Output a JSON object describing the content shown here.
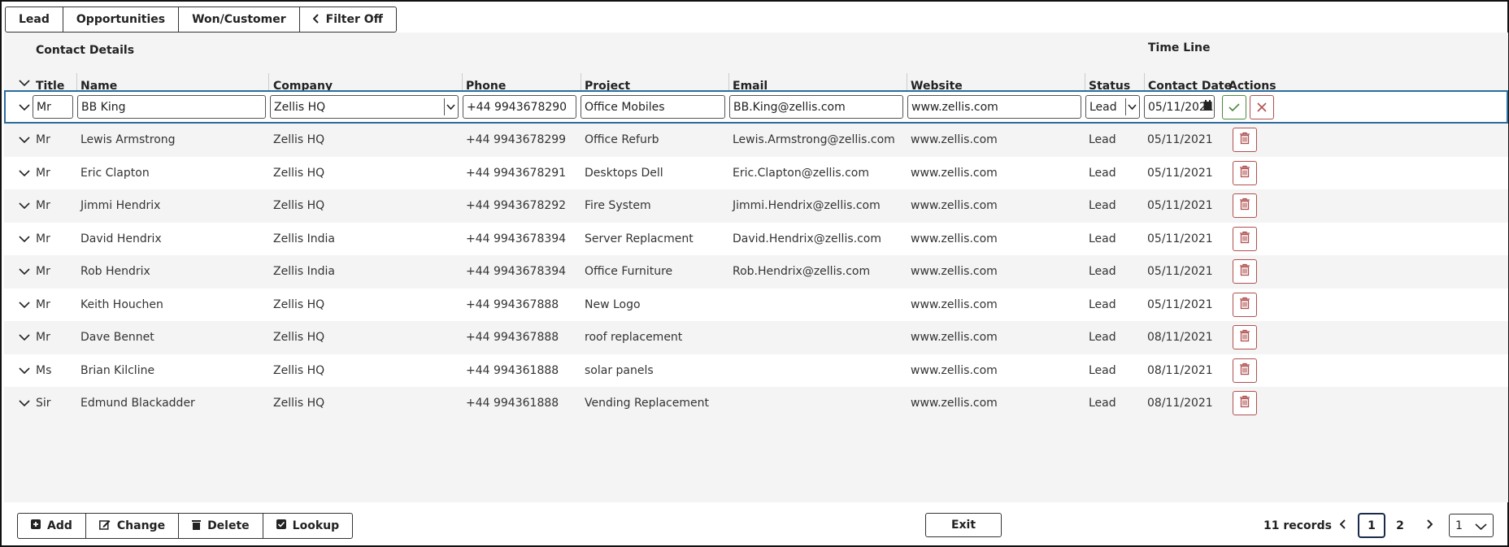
{
  "tabs": [
    {
      "label": "Lead"
    },
    {
      "label": "Opportunities"
    },
    {
      "label": "Won/Customer"
    },
    {
      "label": "Filter Off"
    }
  ],
  "grid": {
    "group_contact": "Contact Details",
    "group_timeline": "Time Line",
    "columns": {
      "title": "Title",
      "name": "Name",
      "company": "Company",
      "phone": "Phone",
      "project": "Project",
      "email": "Email",
      "website": "Website",
      "status": "Status",
      "contact_date": "Contact Date",
      "actions": "Actions"
    },
    "edit_row": {
      "title": "Mr",
      "name": "BB King",
      "company": "Zellis HQ",
      "phone": "+44 9943678290",
      "project": "Office Mobiles",
      "email": "BB.King@zellis.com",
      "website": "www.zellis.com",
      "status": "Lead",
      "contact_date": "05/11/2021"
    },
    "rows": [
      {
        "title": "Mr",
        "name": "Lewis Armstrong",
        "company": "Zellis HQ",
        "phone": "+44 9943678299",
        "project": "Office Refurb",
        "email": "Lewis.Armstrong@zellis.com",
        "website": "www.zellis.com",
        "status": "Lead",
        "date": "05/11/2021"
      },
      {
        "title": "Mr",
        "name": "Eric Clapton",
        "company": "Zellis HQ",
        "phone": "+44 9943678291",
        "project": "Desktops Dell",
        "email": "Eric.Clapton@zellis.com",
        "website": "www.zellis.com",
        "status": "Lead",
        "date": "05/11/2021"
      },
      {
        "title": "Mr",
        "name": "Jimmi Hendrix",
        "company": "Zellis HQ",
        "phone": "+44 9943678292",
        "project": "Fire System",
        "email": "Jimmi.Hendrix@zellis.com",
        "website": "www.zellis.com",
        "status": "Lead",
        "date": "05/11/2021"
      },
      {
        "title": "Mr",
        "name": "David Hendrix",
        "company": "Zellis India",
        "phone": "+44 9943678394",
        "project": "Server Replacment",
        "email": "David.Hendrix@zellis.com",
        "website": "www.zellis.com",
        "status": "Lead",
        "date": "05/11/2021"
      },
      {
        "title": "Mr",
        "name": "Rob Hendrix",
        "company": "Zellis India",
        "phone": "+44 9943678394",
        "project": "Office Furniture",
        "email": "Rob.Hendrix@zellis.com",
        "website": "www.zellis.com",
        "status": "Lead",
        "date": "05/11/2021"
      },
      {
        "title": "Mr",
        "name": "Keith Houchen",
        "company": "Zellis HQ",
        "phone": "+44 994367888",
        "project": "New Logo",
        "email": "",
        "website": "www.zellis.com",
        "status": "Lead",
        "date": "05/11/2021"
      },
      {
        "title": "Mr",
        "name": "Dave Bennet",
        "company": "Zellis HQ",
        "phone": "+44 994367888",
        "project": "roof replacement",
        "email": "",
        "website": "www.zellis.com",
        "status": "Lead",
        "date": "08/11/2021"
      },
      {
        "title": "Ms",
        "name": "Brian Kilcline",
        "company": "Zellis HQ",
        "phone": "+44 994361888",
        "project": "solar panels",
        "email": "",
        "website": "www.zellis.com",
        "status": "Lead",
        "date": "08/11/2021"
      },
      {
        "title": "Sir",
        "name": "Edmund Blackadder",
        "company": "Zellis HQ",
        "phone": "+44 994361888",
        "project": "Vending Replacement",
        "email": "",
        "website": "www.zellis.com",
        "status": "Lead",
        "date": "08/11/2021"
      }
    ]
  },
  "footer": {
    "add": "Add",
    "change": "Change",
    "delete": "Delete",
    "lookup": "Lookup",
    "exit": "Exit",
    "records": "11 records",
    "pages": [
      "1",
      "2"
    ],
    "current_page": "1",
    "page_size": "1"
  },
  "colors": {
    "accent_border": "#2b6c9e",
    "delete_red": "#b05050",
    "ok_green": "#4b8a3a"
  }
}
